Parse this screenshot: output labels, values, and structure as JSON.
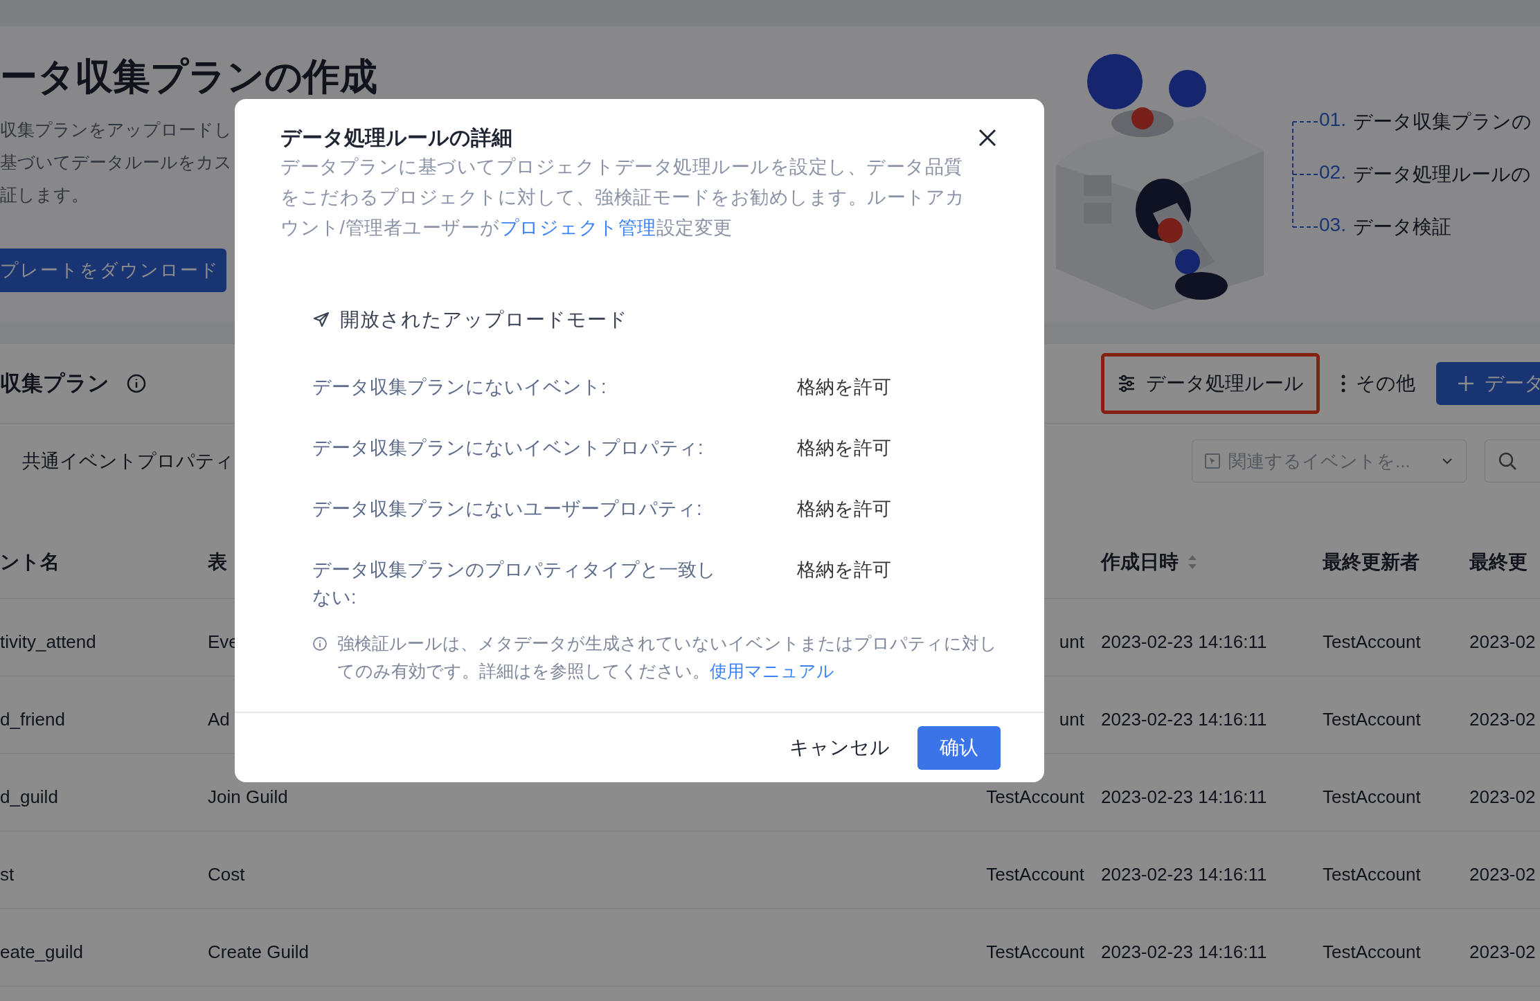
{
  "hero": {
    "title": "ータ収集プランの作成",
    "description": [
      "収集プランをアップロードし",
      "基づいてデータルールをカス",
      "証します。"
    ],
    "download_button": "プレートをダウンロード",
    "steps": [
      {
        "number": "01.",
        "label": "データ収集プランの"
      },
      {
        "number": "02.",
        "label": "データ処理ルールの"
      },
      {
        "number": "03.",
        "label": "データ検証"
      }
    ]
  },
  "section": {
    "title": "収集プラン",
    "toolbar": [
      {
        "kind": "outline",
        "label": "データ処理ルール",
        "highlighted": true
      },
      {
        "kind": "more",
        "label": "その他",
        "highlighted": false
      },
      {
        "kind": "primary",
        "label": "データ",
        "highlighted": false
      }
    ],
    "tab": "共通イベントプロパティ",
    "event_select": {
      "placeholder": "関連するイベントを..."
    }
  },
  "table": {
    "columns": [
      {
        "label": "ント名",
        "sortable": false
      },
      {
        "label": "表"
      },
      {},
      {
        "label": "作成日時",
        "sortable": true
      },
      {
        "label": "最終更新者",
        "sortable": false
      },
      {
        "label": "最終更",
        "sortable": false
      }
    ],
    "rows": [
      [
        "tivity_attend",
        "Eve",
        "unt",
        "2023-02-23 14:16:11",
        "TestAccount",
        "2023-02"
      ],
      [
        "d_friend",
        "Ad",
        "unt",
        "2023-02-23 14:16:11",
        "TestAccount",
        "2023-02"
      ],
      [
        "d_guild",
        "Join Guild",
        "TestAccount",
        "2023-02-23 14:16:11",
        "TestAccount",
        "2023-02"
      ],
      [
        "st",
        "Cost",
        "TestAccount",
        "2023-02-23 14:16:11",
        "TestAccount",
        "2023-02"
      ],
      [
        "eate_guild",
        "Create Guild",
        "TestAccount",
        "2023-02-23 14:16:11",
        "TestAccount",
        "2023-02"
      ]
    ]
  },
  "dialog": {
    "title": "データ処理ルールの詳細",
    "description": {
      "before": "データプランに基づいてプロジェクトデータ処理ルールを設定し、データ品質をこだわるプロジェクトに対して、強検証モードをお勧めします。ルートアカウント/管理者ユーザーが",
      "link": "プロジェクト管理",
      "after": "設定変更"
    },
    "mode": "開放されたアップロードモード",
    "rules": [
      {
        "label": "データ収集プランにないイベント:",
        "value": "格納を許可"
      },
      {
        "label": "データ収集プランにないイベントプロパティ:",
        "value": "格納を許可"
      },
      {
        "label": "データ収集プランにないユーザープロパティ:",
        "value": "格納を許可"
      },
      {
        "label": "データ収集プランのプロパティタイプと一致しない:",
        "value": "格納を許可"
      }
    ],
    "note": {
      "text": "強検証ルールは、メタデータが生成されていないイベントまたはプロパティに対してのみ有効です。詳細はを参照してください。",
      "link": "使用マニュアル"
    },
    "cancel": "キャンセル",
    "confirm": "确认"
  }
}
